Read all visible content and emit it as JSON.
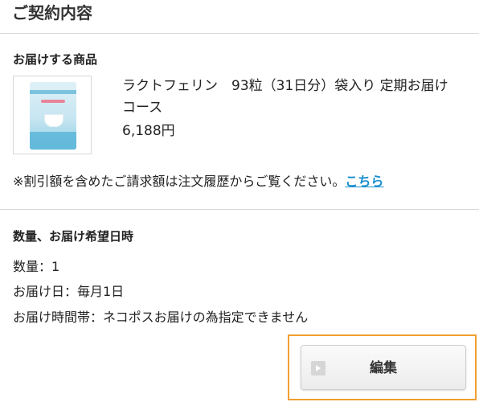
{
  "page_title": "ご契約内容",
  "product_section": {
    "heading": "お届けする商品",
    "product_name": "ラクトフェリン　93粒（31日分）袋入り 定期お届けコース",
    "price": "6,188円"
  },
  "notice": {
    "text": "※割引額を含めたご請求額は注文履歴からご覧ください。",
    "link_label": "こちら"
  },
  "delivery_section": {
    "heading": "数量、お届け希望日時",
    "quantity": "数量：1",
    "delivery_day": "お届け日：毎月1日",
    "time_slot": "お届け時間帯：ネコポスお届けの為指定できません"
  },
  "edit_button": {
    "label": "編集",
    "icon": "arrow-right-icon"
  },
  "colors": {
    "link": "#1a8fce",
    "highlight_border": "#f0a030",
    "divider": "#d9d9d9"
  }
}
